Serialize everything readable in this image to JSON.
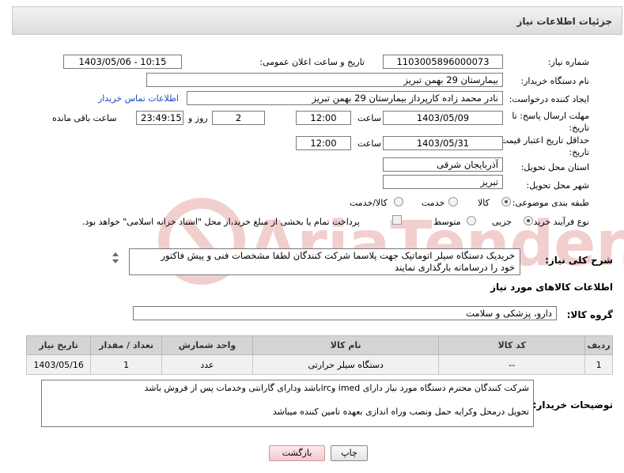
{
  "header": {
    "title": "جزئیات اطلاعات نیاز"
  },
  "form": {
    "need_number_label": "شماره نیاز:",
    "need_number": "1103005896000073",
    "announce_label": "تاریخ و ساعت اعلان عمومی:",
    "announce_value": "1403/05/06 - 10:15",
    "buyer_org_label": "نام دستگاه خریدار:",
    "buyer_org": "بیمارستان 29 بهمن تبریز",
    "creator_label": "ایجاد کننده درخواست:",
    "creator": "نادر محمد زاده کارپرداز بیمارستان 29 بهمن تبریز",
    "contact_link": "اطلاعات تماس خریدار",
    "deadline_label": "مهلت ارسال پاسخ: تا تاریخ:",
    "deadline_date": "1403/05/09",
    "time_label": "ساعت",
    "deadline_time": "12:00",
    "days_value": "2",
    "days_label": "روز و",
    "remaining_time": "23:49:15",
    "remaining_label": "ساعت باقی مانده",
    "validity_label": "حداقل تاریخ اعتبار قیمت: تا تاریخ:",
    "validity_date": "1403/05/31",
    "validity_time": "12:00",
    "province_label": "استان محل تحویل:",
    "province": "آذربایجان شرقی",
    "city_label": "شهر محل تحویل:",
    "city": "تبریز",
    "category_label": "طبقه بندی موضوعی:",
    "category_options": [
      "کالا",
      "خدمت",
      "کالا/خدمت"
    ],
    "category_selected": "کالا",
    "process_label": "نوع فرآیند خرید :",
    "process_options": [
      "جزیی",
      "متوسط"
    ],
    "process_selected": "جزیی",
    "payment_note": "پرداخت تمام یا بخشی از مبلغ خرید،از محل \"اسناد خزانه اسلامی\" خواهد بود."
  },
  "description": {
    "label": "شرح کلی نیاز:",
    "text": "خریدیک دستگاه سیلر اتوماتیک جهت پلاسما    شرکت کنندگان لطفا مشخصات فنی و پیش فاکتور خود را درسامانه بارگذاری نمایند"
  },
  "goods": {
    "section_title": "اطلاعات کالاهای مورد نیاز",
    "group_label": "گروه کالا:",
    "group_value": "دارو، پزشکی و سلامت",
    "columns": [
      "ردیف",
      "کد کالا",
      "نام کالا",
      "واحد شمارش",
      "تعداد / مقدار",
      "تاریخ نیاز"
    ],
    "rows": [
      {
        "row": "1",
        "code": "--",
        "name": "دستگاه سیلر حرارتی",
        "unit": "عدد",
        "qty": "1",
        "date": "1403/05/16"
      }
    ]
  },
  "buyer_notes": {
    "label": "توضیحات خریدار:",
    "line1": "شرکت کنندگان محترم دستگاه مورد نیاز دارای imed وircباشد ودارای گارانتی وخدمات پس از فروش باشد",
    "line2": "تحویل درمحل وکرایه حمل ونصب وراه اندازی بعهده تامین کننده میباشد"
  },
  "buttons": {
    "print": "چاپ",
    "back": "بازگشت"
  },
  "watermark": {
    "text": "AriaTender.net",
    "color": "#c62828"
  }
}
